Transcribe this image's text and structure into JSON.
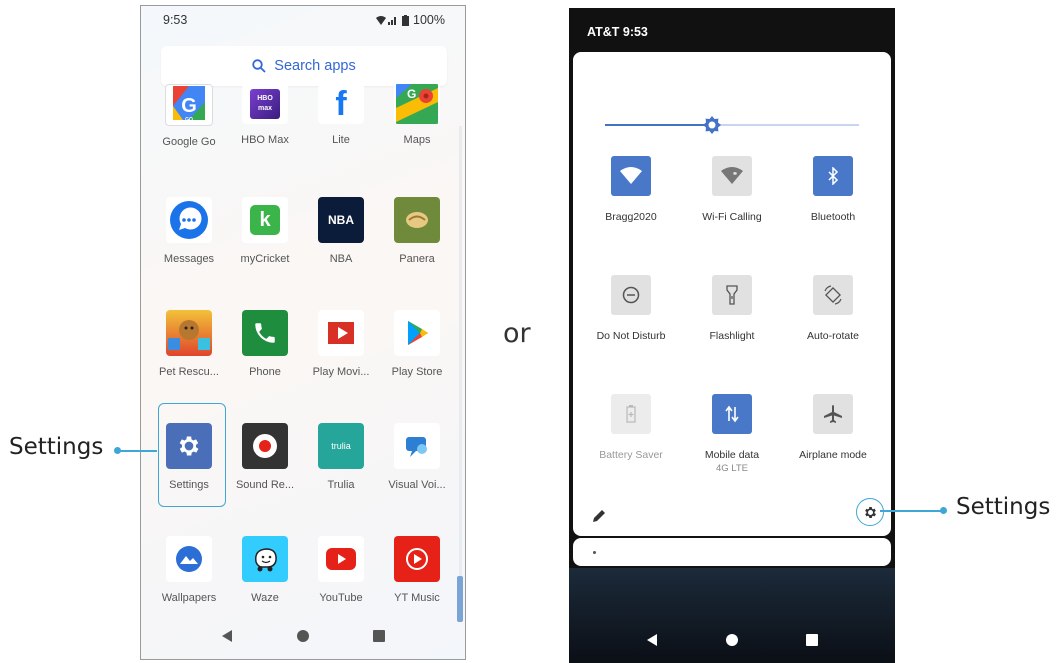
{
  "left_phone": {
    "status": {
      "time": "9:53",
      "battery": "100%"
    },
    "search": {
      "label": "Search apps"
    },
    "apps": [
      {
        "label": "Google Go",
        "icon": "google-go-icon",
        "color": "#4a90d9"
      },
      {
        "label": "HBO Max",
        "icon": "hbo-max-icon",
        "color": "#5b2fa8"
      },
      {
        "label": "Lite",
        "icon": "facebook-lite-icon",
        "color": "#1877f2"
      },
      {
        "label": "Maps",
        "icon": "maps-icon",
        "color": "#34a853"
      },
      {
        "label": "Messages",
        "icon": "messages-icon",
        "color": "#1a73e8"
      },
      {
        "label": "myCricket",
        "icon": "mycricket-icon",
        "color": "#3bb54a"
      },
      {
        "label": "NBA",
        "icon": "nba-icon",
        "color": "#0b1b3a"
      },
      {
        "label": "Panera",
        "icon": "panera-icon",
        "color": "#6f8a3a"
      },
      {
        "label": "Pet Rescu...",
        "icon": "pet-rescue-icon",
        "color": "#e0a12a"
      },
      {
        "label": "Phone",
        "icon": "phone-icon",
        "color": "#1e8e3e"
      },
      {
        "label": "Play Movi...",
        "icon": "play-movies-icon",
        "color": "#d93025"
      },
      {
        "label": "Play Store",
        "icon": "play-store-icon",
        "color": "#01875f"
      },
      {
        "label": "Settings",
        "icon": "settings-gear-icon",
        "color": "#4a6fb8"
      },
      {
        "label": "Sound Re...",
        "icon": "sound-recorder-icon",
        "color": "#333333"
      },
      {
        "label": "Trulia",
        "icon": "trulia-icon",
        "color": "#26a69a"
      },
      {
        "label": "Visual Voi...",
        "icon": "visual-voicemail-icon",
        "color": "#2d7fd3"
      },
      {
        "label": "Wallpapers",
        "icon": "wallpapers-icon",
        "color": "#2b6fd6"
      },
      {
        "label": "Waze",
        "icon": "waze-icon",
        "color": "#33ccff"
      },
      {
        "label": "YouTube",
        "icon": "youtube-icon",
        "color": "#e62117"
      },
      {
        "label": "YT Music",
        "icon": "yt-music-icon",
        "color": "#e62117"
      }
    ]
  },
  "middle": {
    "or_text": "or"
  },
  "callouts": {
    "left_label": "Settings",
    "right_label": "Settings"
  },
  "right_phone": {
    "status": {
      "carrier_time": "AT&T  9:53"
    },
    "brightness_level": 0.42,
    "tiles": [
      {
        "label": "Bragg2020",
        "sub": "",
        "icon": "wifi-icon",
        "state": "on"
      },
      {
        "label": "Wi-Fi Calling",
        "sub": "",
        "icon": "wifi-calling-icon",
        "state": "off"
      },
      {
        "label": "Bluetooth",
        "sub": "",
        "icon": "bluetooth-icon",
        "state": "on"
      },
      {
        "label": "Do Not Disturb",
        "sub": "",
        "icon": "do-not-disturb-icon",
        "state": "off"
      },
      {
        "label": "Flashlight",
        "sub": "",
        "icon": "flashlight-icon",
        "state": "off"
      },
      {
        "label": "Auto-rotate",
        "sub": "",
        "icon": "auto-rotate-icon",
        "state": "off"
      },
      {
        "label": "Battery Saver",
        "sub": "",
        "icon": "battery-saver-icon",
        "state": "disabled"
      },
      {
        "label": "Mobile data",
        "sub": "4G LTE",
        "icon": "mobile-data-icon",
        "state": "on"
      },
      {
        "label": "Airplane mode",
        "sub": "",
        "icon": "airplane-icon",
        "state": "off"
      }
    ]
  }
}
